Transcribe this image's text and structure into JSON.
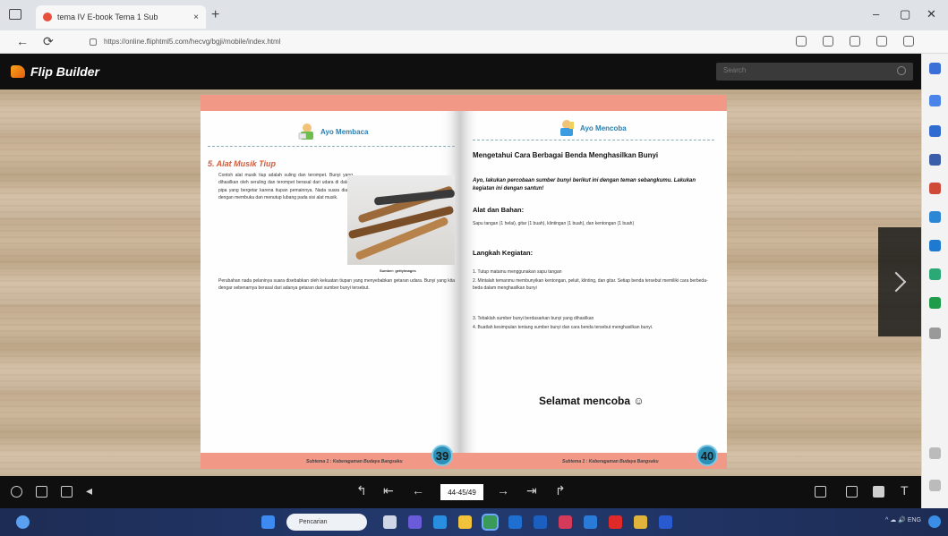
{
  "browser": {
    "tab_title": "tema IV E-book Tema 1 Sub",
    "tab_close": "×",
    "new_tab": "+",
    "address": "https://online.fliphtml5.com/hecvg/bgji/mobile/index.html",
    "back": "←",
    "refresh": "⟳",
    "minimize": "–",
    "maximize": "▢",
    "close": "✕"
  },
  "viewer": {
    "brand": "Flip Builder",
    "search_placeholder": "Search",
    "page_input": "44-45/49"
  },
  "left_page": {
    "section": "Ayo Membaca",
    "subtitle": "5. Alat Musik Tiup",
    "para1": "Contoh alat musik tiup adalah suling dan terompet. Bunyi yang dihasilkan oleh seruling dan terompet berasal dari udara di dalam pipa yang bergetar karena tiupan pemainnya. Nada suara diatur dengan membuka dan menutup lubang pada sisi alat musik.",
    "caption": "Sumber: gettyimages",
    "para2": "Perubahan nada pelaninya suara disebabkan oleh kekuatan tiupan yang menyebabkan getaran udara. Bunyi yang kita dengar sebenarnya berasal dari adanya getaran dari sumber bunyi tersebut.",
    "footer": "Subtema 1 : Keberagaman Budaya Bangsaku",
    "page_number": "39"
  },
  "right_page": {
    "section": "Ayo Mencoba",
    "title": "Mengetahui Cara Berbagai Benda  Menghasilkan Bunyi",
    "intro": "Ayo, lakukan percobaan sumber bunyi berikut ini dengan teman sebangkumu. Lakukan kegiatan ini dengan santun!",
    "materials_heading": "Alat dan Bahan:",
    "materials": "Sapu tangan (1 helai), gitar (1 buah), klintingan (1 buah), dan kentongan (1 buah)",
    "steps_heading": "Langkah Kegiatan:",
    "steps": [
      "1. Tutup matamu menggunakan sapu tangan",
      "2. Mintalah temanmu membunyikan kentongan, peluit, klinting, dan gitar. Setiap benda tersebut memiliki cara berbeda-beda dalam menghasilkan bunyi",
      "3. Tebaklah sumber bunyi berdasarkan bunyi yang dihasilkan",
      "4. Buatlah kesimpulan tentang sumber bunyi dan cara benda tersebut menghasilkan bunyi."
    ],
    "closing": "Selamat mencoba ☺",
    "footer": "Subtema 1 : Keberagaman Budaya Bangsaku",
    "page_number": "40"
  },
  "taskbar": {
    "search": "Pencarian",
    "tray": "^  ☁  🔊  ENG"
  },
  "colors": {
    "band": "#f29886",
    "accent": "#2a7fb0",
    "subtitle": "#d25c3c"
  }
}
